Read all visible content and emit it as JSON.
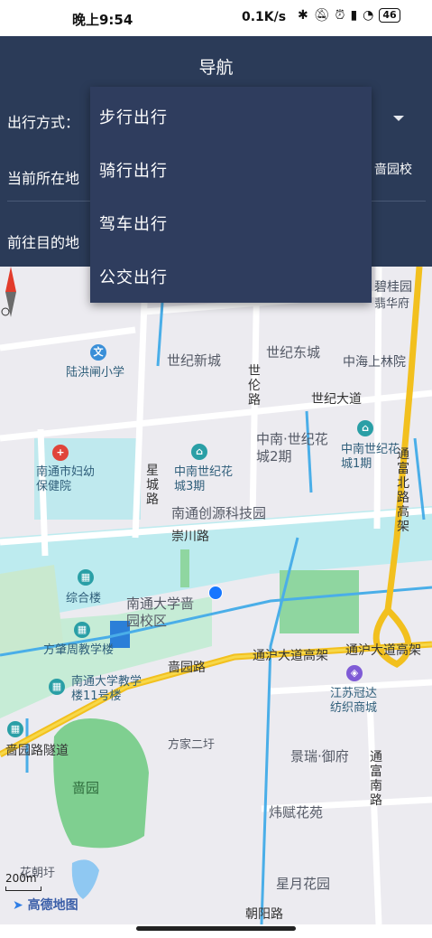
{
  "status_bar": {
    "time": "晚上9:54",
    "net_speed": "0.1K/s",
    "icons": [
      "bluetooth-icon",
      "mute-icon",
      "alarm-icon",
      "hd-signal-icon",
      "wifi-icon"
    ],
    "battery": "46"
  },
  "header": {
    "title": "导航",
    "mode_label": "出行方式：",
    "current_label": "当前所在地",
    "current_value": "啬园校",
    "dest_label": "前往目的地",
    "bg_color": "#2b3b58"
  },
  "dropdown": {
    "items": [
      "步行出行",
      "骑行出行",
      "驾车出行",
      "公交出行"
    ]
  },
  "map": {
    "labels": {
      "bigui": "碧桂园",
      "zuihua": "翡华府",
      "shijixincheng": "世纪新城",
      "shijidongcheng": "世纪东城",
      "zhonghai": "中海上林院",
      "luhongzha": "陆洪闸小学",
      "shijilu": "世伦路",
      "shijidadao": "世纪大道",
      "fuyou": "南通市妇幼保健院",
      "zhongnan3": "中南世纪花城3期",
      "zhongnan_sj": "中南·世纪花城2期",
      "zhongnan1": "中南世纪花城1期",
      "xingchenglu": "星城路",
      "tongfu_gj": "通富北路高架",
      "chuangyuan": "南通创源科技园",
      "chongchuanlu": "崇川路",
      "zonghelou": "综合楼",
      "ntu_yy": "南通大学啬园校区",
      "fangzhaozhou": "方肇周教学楼",
      "seyuanlu": "啬园路",
      "tonghu_gj": "通沪大道高架",
      "tonghu_gj2": "通沪大道高架",
      "ntu11": "南通大学教学楼11号楼",
      "jiangsu": "江苏冠达纺织商城",
      "seyuan_tunnel": "啬园路隧道",
      "fangjia": "方家二圩",
      "jingrui": "景瑞·御府",
      "tongfu_nan": "通富南路",
      "seyuan": "啬园",
      "weifu": "炜赋花苑",
      "huachao": "花朝圩",
      "xingyue": "星月花园",
      "chaoyang": "朝阳路"
    },
    "scale": "200m",
    "logo": "高德地图"
  }
}
